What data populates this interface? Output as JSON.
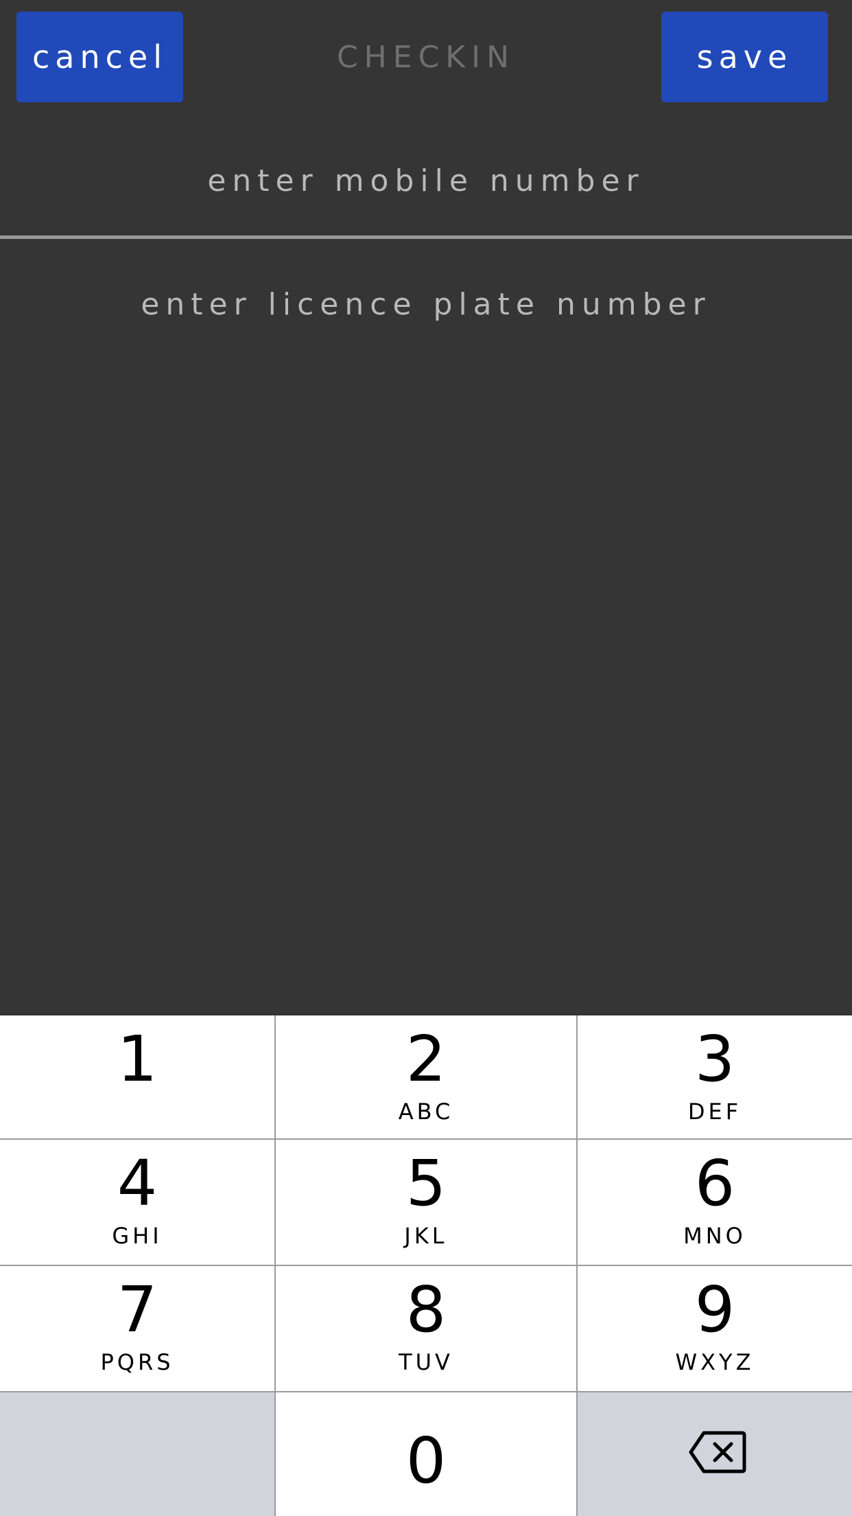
{
  "header": {
    "cancel_label": "cancel",
    "title": "CHECKIN",
    "save_label": "save"
  },
  "form": {
    "mobile_placeholder": "enter mobile number",
    "plate_placeholder": "enter licence plate number"
  },
  "keypad": {
    "keys": [
      {
        "digit": "1",
        "letters": ""
      },
      {
        "digit": "2",
        "letters": "ABC"
      },
      {
        "digit": "3",
        "letters": "DEF"
      },
      {
        "digit": "4",
        "letters": "GHI"
      },
      {
        "digit": "5",
        "letters": "JKL"
      },
      {
        "digit": "6",
        "letters": "MNO"
      },
      {
        "digit": "7",
        "letters": "PQRS"
      },
      {
        "digit": "8",
        "letters": "TUV"
      },
      {
        "digit": "9",
        "letters": "WXYZ"
      },
      {
        "digit": "0",
        "letters": ""
      }
    ],
    "backspace_icon": "backspace-icon"
  },
  "colors": {
    "background": "#353535",
    "button": "#2149b9",
    "key": "#ffffff",
    "key_gray": "#d1d4db"
  }
}
